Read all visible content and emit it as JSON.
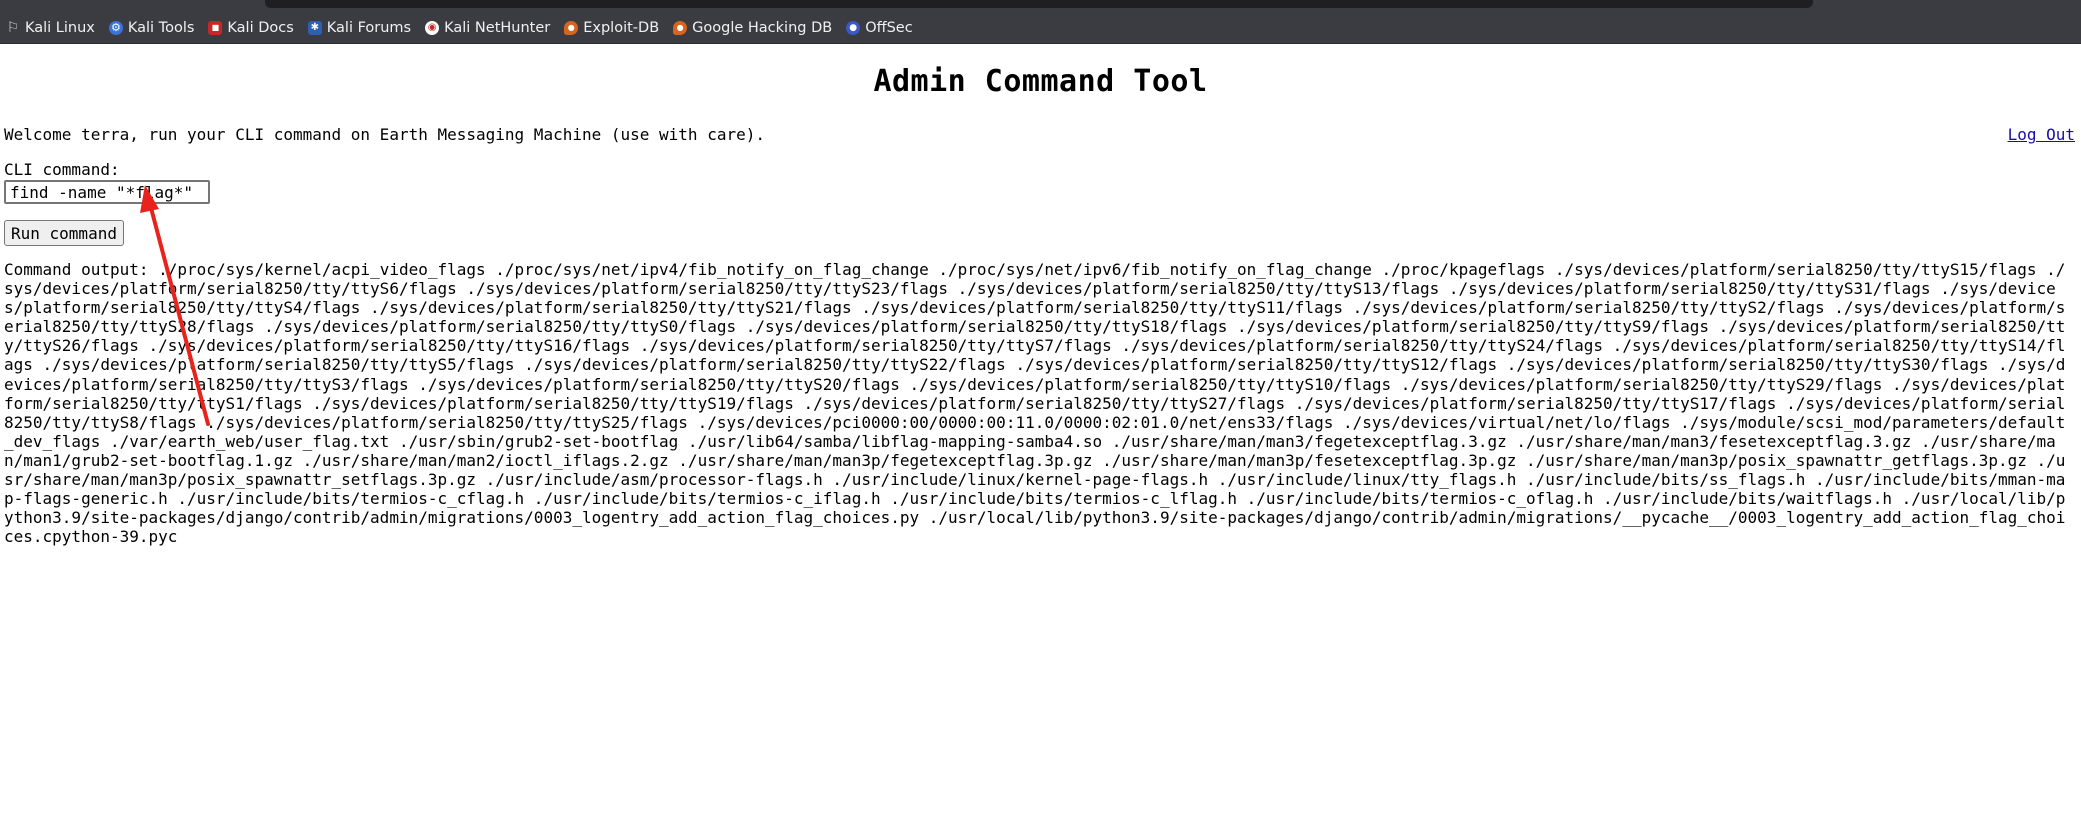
{
  "browser": {
    "bookmarks": [
      {
        "label": "Kali Linux",
        "icon": "kali-dragon-icon"
      },
      {
        "label": "Kali Tools",
        "icon": "kali-tools-icon"
      },
      {
        "label": "Kali Docs",
        "icon": "kali-docs-icon"
      },
      {
        "label": "Kali Forums",
        "icon": "kali-forums-icon"
      },
      {
        "label": "Kali NetHunter",
        "icon": "nethunter-icon"
      },
      {
        "label": "Exploit-DB",
        "icon": "exploit-db-icon"
      },
      {
        "label": "Google Hacking DB",
        "icon": "ghdb-icon"
      },
      {
        "label": "OffSec",
        "icon": "offsec-icon"
      }
    ]
  },
  "page": {
    "title": "Admin Command Tool",
    "welcome_text": "Welcome terra, run your CLI command on Earth Messaging Machine (use with care).",
    "logout_label": "Log Out",
    "cli_label": "CLI command:",
    "cli_value": "find -name \"*flag*\"",
    "run_button_label": "Run command",
    "output_label": "Command output:",
    "output_text": "./proc/sys/kernel/acpi_video_flags ./proc/sys/net/ipv4/fib_notify_on_flag_change ./proc/sys/net/ipv6/fib_notify_on_flag_change ./proc/kpageflags ./sys/devices/platform/serial8250/tty/ttyS15/flags ./sys/devices/platform/serial8250/tty/ttyS6/flags ./sys/devices/platform/serial8250/tty/ttyS23/flags ./sys/devices/platform/serial8250/tty/ttyS13/flags ./sys/devices/platform/serial8250/tty/ttyS31/flags ./sys/devices/platform/serial8250/tty/ttyS4/flags ./sys/devices/platform/serial8250/tty/ttyS21/flags ./sys/devices/platform/serial8250/tty/ttyS11/flags ./sys/devices/platform/serial8250/tty/ttyS2/flags ./sys/devices/platform/serial8250/tty/ttyS28/flags ./sys/devices/platform/serial8250/tty/ttyS0/flags ./sys/devices/platform/serial8250/tty/ttyS18/flags ./sys/devices/platform/serial8250/tty/ttyS9/flags ./sys/devices/platform/serial8250/tty/ttyS26/flags ./sys/devices/platform/serial8250/tty/ttyS16/flags ./sys/devices/platform/serial8250/tty/ttyS7/flags ./sys/devices/platform/serial8250/tty/ttyS24/flags ./sys/devices/platform/serial8250/tty/ttyS14/flags ./sys/devices/platform/serial8250/tty/ttyS5/flags ./sys/devices/platform/serial8250/tty/ttyS22/flags ./sys/devices/platform/serial8250/tty/ttyS12/flags ./sys/devices/platform/serial8250/tty/ttyS30/flags ./sys/devices/platform/serial8250/tty/ttyS3/flags ./sys/devices/platform/serial8250/tty/ttyS20/flags ./sys/devices/platform/serial8250/tty/ttyS10/flags ./sys/devices/platform/serial8250/tty/ttyS29/flags ./sys/devices/platform/serial8250/tty/ttyS1/flags ./sys/devices/platform/serial8250/tty/ttyS19/flags ./sys/devices/platform/serial8250/tty/ttyS27/flags ./sys/devices/platform/serial8250/tty/ttyS17/flags ./sys/devices/platform/serial8250/tty/ttyS8/flags ./sys/devices/platform/serial8250/tty/ttyS25/flags ./sys/devices/pci0000:00/0000:00:11.0/0000:02:01.0/net/ens33/flags ./sys/devices/virtual/net/lo/flags ./sys/module/scsi_mod/parameters/default_dev_flags ./var/earth_web/user_flag.txt ./usr/sbin/grub2-set-bootflag ./usr/lib64/samba/libflag-mapping-samba4.so ./usr/share/man/man3/fegetexceptflag.3.gz ./usr/share/man/man3/fesetexceptflag.3.gz ./usr/share/man/man1/grub2-set-bootflag.1.gz ./usr/share/man/man2/ioctl_iflags.2.gz ./usr/share/man/man3p/fegetexceptflag.3p.gz ./usr/share/man/man3p/fesetexceptflag.3p.gz ./usr/share/man/man3p/posix_spawnattr_getflags.3p.gz ./usr/share/man/man3p/posix_spawnattr_setflags.3p.gz ./usr/include/asm/processor-flags.h ./usr/include/linux/kernel-page-flags.h ./usr/include/linux/tty_flags.h ./usr/include/bits/ss_flags.h ./usr/include/bits/mman-map-flags-generic.h ./usr/include/bits/termios-c_cflag.h ./usr/include/bits/termios-c_iflag.h ./usr/include/bits/termios-c_lflag.h ./usr/include/bits/termios-c_oflag.h ./usr/include/bits/waitflags.h ./usr/local/lib/python3.9/site-packages/django/contrib/admin/migrations/0003_logentry_add_action_flag_choices.py ./usr/local/lib/python3.9/site-packages/django/contrib/admin/migrations/__pycache__/0003_logentry_add_action_flag_choices.cpython-39.pyc"
  },
  "annotation": {
    "color": "#e8231c"
  }
}
